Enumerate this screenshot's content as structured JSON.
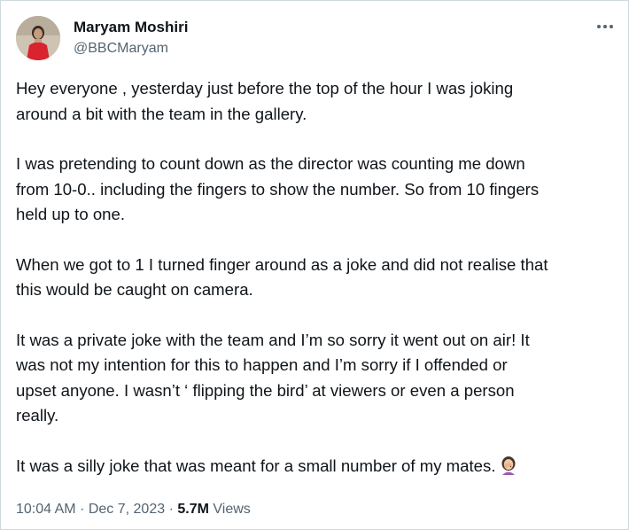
{
  "author": {
    "display_name": "Maryam Moshiri",
    "handle": "@BBCMaryam"
  },
  "more_icon": "more-horizontal-icon",
  "tweet": {
    "paragraphs": [
      "Hey everyone , yesterday just before the top of the hour I was joking\naround a bit with the team in the gallery.",
      "I was pretending to count down as the director was counting me down\nfrom 10-0.. including the fingers to show the number. So from 10 fingers\nheld up to one.",
      "When we got to 1 I turned finger around as a joke and did not realise that\nthis would be caught on camera.",
      "It was a private joke with the team and I’m so sorry it went out on air! It\nwas not my intention for this to happen and I’m sorry if I offended or\nupset anyone. I wasn’t ‘ flipping the bird’ at viewers or even a person\nreally.",
      "It was a silly joke that was meant for a small number of my mates."
    ],
    "emoji": "woman-facepalming-emoji"
  },
  "meta": {
    "time": "10:04 AM",
    "separator": "·",
    "date": "Dec 7, 2023",
    "views_count": "5.7M",
    "views_label": "Views"
  },
  "colors": {
    "text": "#0f1419",
    "secondary": "#536471",
    "border": "#cfd9de",
    "avatar_dress": "#d9232e"
  }
}
